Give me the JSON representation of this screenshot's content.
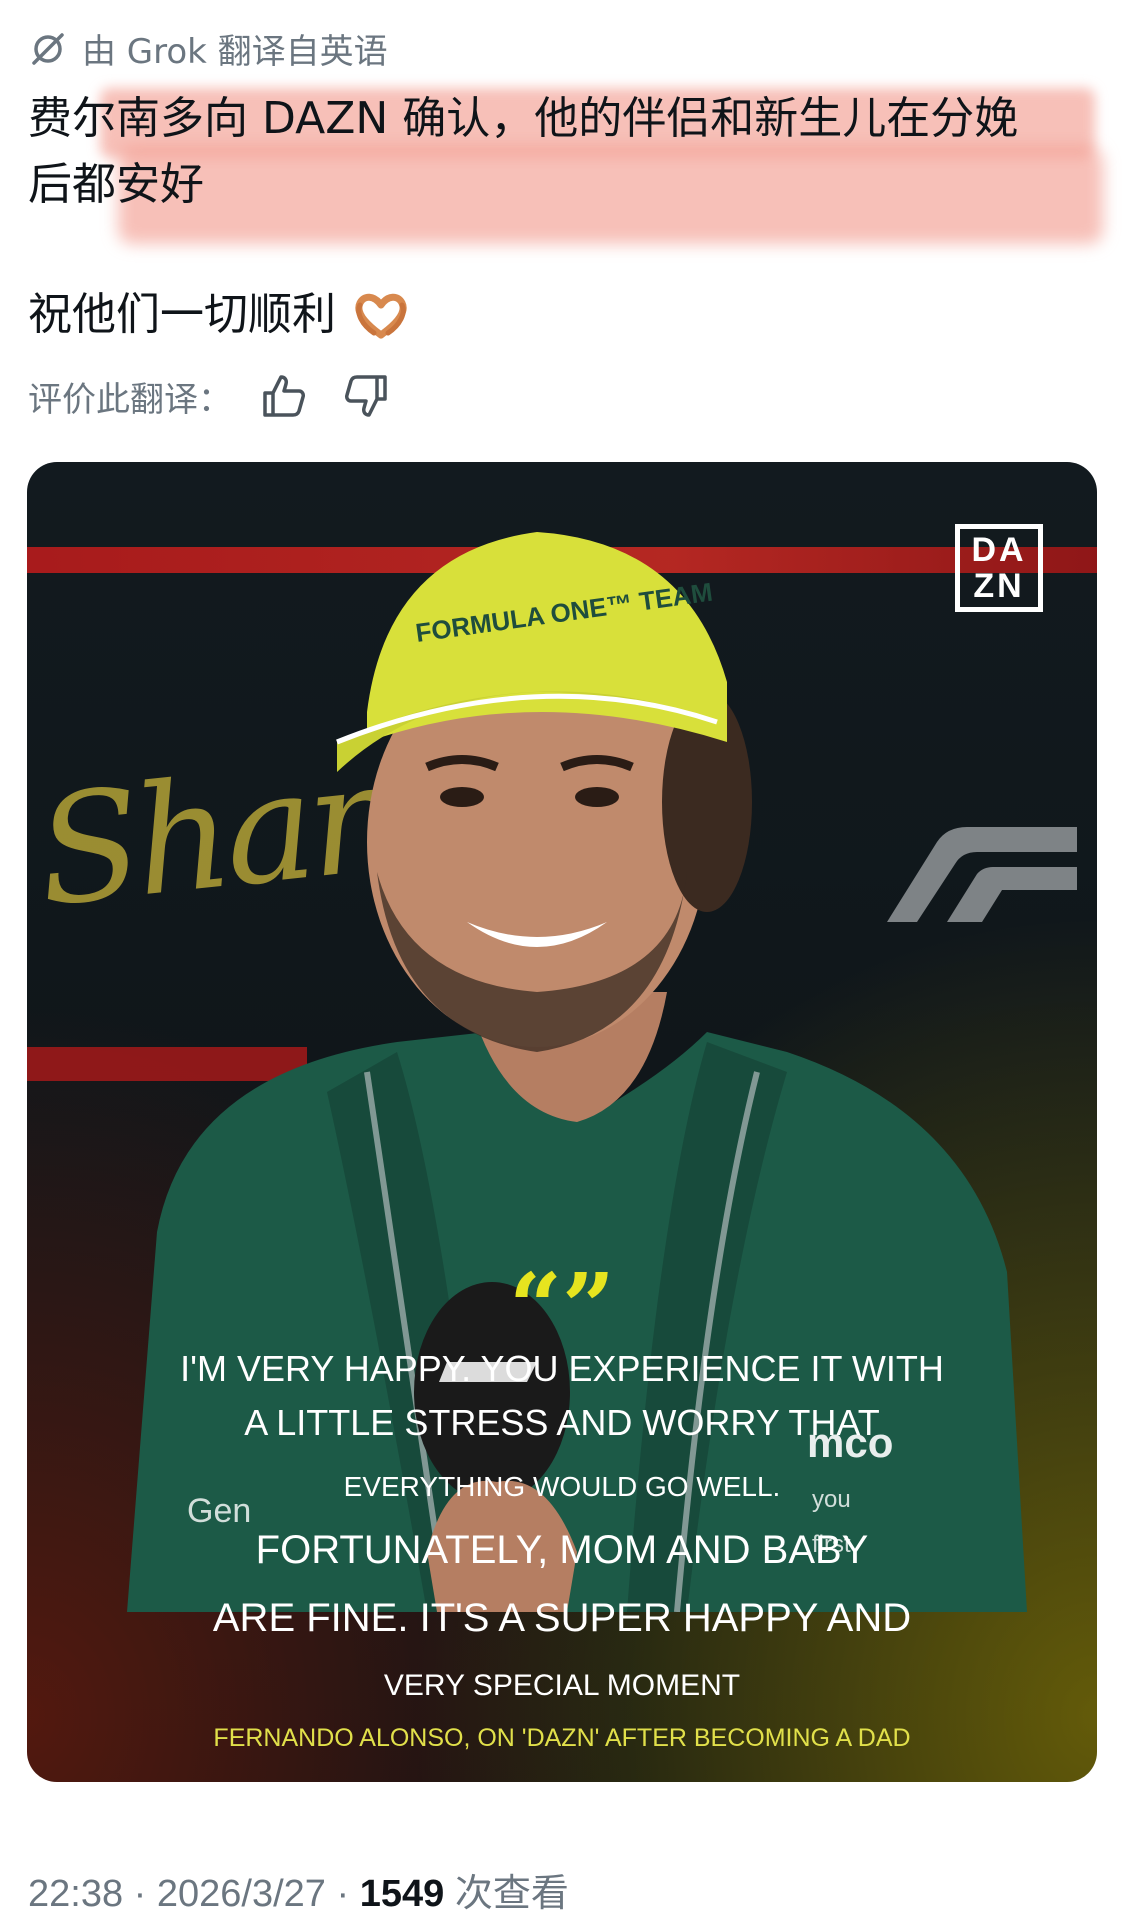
{
  "translation_notice": "由 Grok 翻译自英语",
  "tweet": {
    "line1": "费尔南多向 DAZN 确认，他的伴侣和新生儿在分娩",
    "line2": "后都安好",
    "wish": "祝他们一切顺利",
    "wish_emoji": "heart-hands-emoji"
  },
  "rate": {
    "label": "评价此翻译："
  },
  "card": {
    "logo_line1": "DA",
    "logo_line2": "ZN",
    "background_text": "Shanghai",
    "quote_open": "“”",
    "quote_1": "I'M VERY HAPPY. YOU EXPERIENCE IT WITH",
    "quote_2": "A LITTLE STRESS AND WORRY THAT",
    "quote_3": "EVERYTHING WOULD GO WELL.",
    "quote_4": "FORTUNATELY, MOM AND BABY",
    "quote_5": "ARE FINE. IT'S A SUPER HAPPY AND",
    "quote_6": "VERY SPECIAL MOMENT",
    "attribution": "FERNANDO ALONSO, ON 'DAZN' AFTER BECOMING A DAD"
  },
  "meta": {
    "time": "22:38",
    "date": "2026/3/27",
    "views": "1549",
    "views_label": "次查看"
  },
  "colors": {
    "highlight": "#f08c7d",
    "accent_yellow": "#e6e41f",
    "text_secondary": "#6b7680"
  }
}
